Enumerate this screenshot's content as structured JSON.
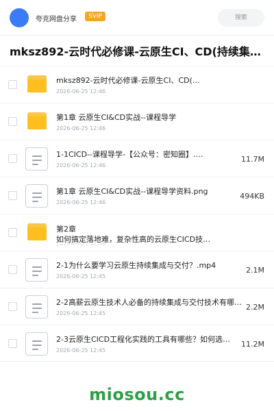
{
  "header": {
    "username": "夸克网盘分享",
    "badge": "SVIP",
    "search_label": "搜索"
  },
  "folder_title": "mksz892-云时代必修课-云原生CI、CD(持续集成与交付…",
  "files": [
    {
      "type": "folder",
      "name": "mksz892-云时代必修课-云原生CI、CD(持…",
      "date": "2026-06-25 12:46",
      "size": ""
    },
    {
      "type": "folder",
      "name": "第1章 云原生CI&CD实战--课程导学",
      "date": "2026-06-25 12:46",
      "size": ""
    },
    {
      "type": "file",
      "name": "1-1CICD--课程导学-【公众号：密知圈】.m…",
      "date": "2026-06-25 12:46",
      "size": "11.7M"
    },
    {
      "type": "file",
      "name": "第1章 云原生CI&CD实战--课程导学资料.png",
      "date": "2026-06-25 12:46",
      "size": "494KB"
    },
    {
      "type": "folder",
      "name": "第2章",
      "name_line2": "如何搞定落地难，复杂性高的云原生CICD技…",
      "date": "2026-06-25 12:46",
      "size": ""
    },
    {
      "type": "file",
      "name": "2-1为什么要学习云原生持续集成与交付？.mp4",
      "date": "2026-06-25 12:45",
      "size": "2.1M"
    },
    {
      "type": "file",
      "name": "2-2高薪云原生技术人必备的持续集成与交付技术有哪…",
      "date": "2026-06-25 12:45",
      "size": "2.2M"
    },
    {
      "type": "file",
      "name": "2-3云原生CICD工程化实践的工具有哪些？如何选…",
      "date": "2026-06-25 12:45",
      "size": "11.2M"
    }
  ],
  "watermark": "miosou.cc",
  "colors": {
    "accent": "#3c7bf6",
    "badge": "#f5a623",
    "folder": "#ffbf1f",
    "watermark": "#2e9e47"
  }
}
